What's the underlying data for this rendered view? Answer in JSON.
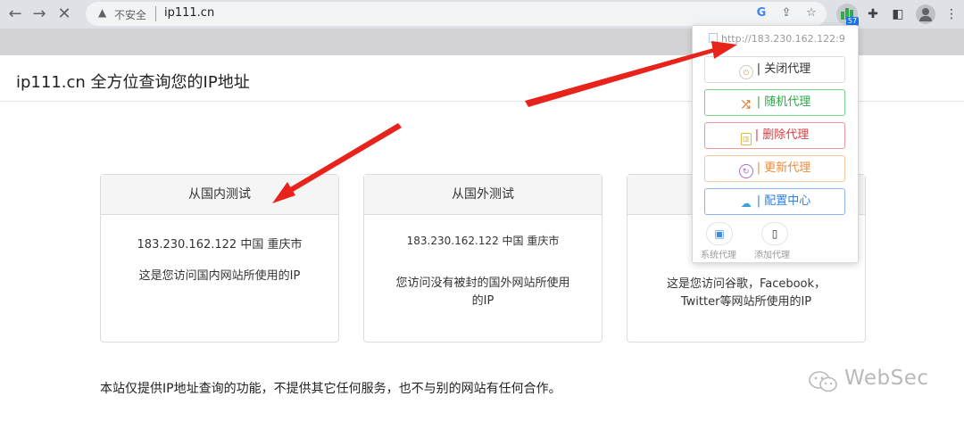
{
  "browser": {
    "security_label": "不安全",
    "url": "ip111.cn",
    "extension_badge": "57",
    "back_icon": "←",
    "forward_icon": "→",
    "stop_icon": "✕"
  },
  "page": {
    "brand": "ip111.cn 全方位查询您的IP地址",
    "cards": [
      {
        "title": "从国内测试",
        "ip": "183.230.162.122 中国 重庆市",
        "desc": "这是您访问国内网站所使用的IP"
      },
      {
        "title": "从国外测试",
        "ip": "183.230.162.122 中国 重庆市",
        "desc": "您访问没有被封的国外网站所使用的IP"
      },
      {
        "title": "",
        "ip": "",
        "desc": "这是您访问谷歌，Facebook，Twitter等网站所使用的IP"
      }
    ],
    "notice": "本站仅提供IP地址查询的功能，不提供其它任何服务，也不与别的网站有任何合作。",
    "watermark": "WebSec"
  },
  "popup": {
    "proxy_url": "http://183.230.162.122:9",
    "buttons": {
      "close": "| 关闭代理",
      "random": "| 随机代理",
      "delete": "| 删除代理",
      "update": "| 更新代理",
      "config": "| 配置中心"
    },
    "system_proxy_label": "系统代理",
    "add_proxy_label": "添加代理"
  },
  "colors": {
    "annotation_arrow": "#e8231b",
    "random_green": "#2aa845",
    "delete_red": "#e03a3f",
    "update_orange": "#f0893b",
    "config_blue": "#2f7ee0"
  }
}
